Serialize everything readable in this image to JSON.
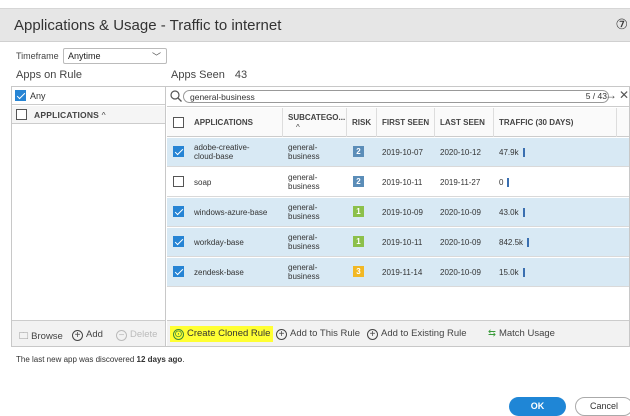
{
  "dialog": {
    "title": "Applications & Usage - Traffic to internet",
    "help_icon": "help-icon"
  },
  "timeframe": {
    "label": "Timeframe",
    "value": "Anytime"
  },
  "left": {
    "header": "Apps on Rule",
    "any_label": "Any",
    "column_header": "APPLICATIONS",
    "sort_glyph": "^",
    "footer": {
      "browse": "Browse",
      "add": "Add",
      "delete": "Delete"
    }
  },
  "right": {
    "header": "Apps Seen",
    "count": "43",
    "search": {
      "value": "general-business",
      "count": "5 / 43"
    },
    "columns": [
      "APPLICATIONS",
      "SUBCATEGO...",
      "RISK",
      "FIRST SEEN",
      "LAST SEEN",
      "TRAFFIC (30 DAYS)"
    ],
    "sort_glyph": "^",
    "rows": [
      {
        "checked": true,
        "app_l1": "adobe-creative-",
        "app_l2": "cloud-base",
        "sub_l1": "general-",
        "sub_l2": "business",
        "risk": "2",
        "risk_color": "#5b8db8",
        "first": "2019-10-07",
        "last": "2020-10-12",
        "traffic": "47.9k"
      },
      {
        "checked": false,
        "app_l1": "soap",
        "app_l2": "",
        "sub_l1": "general-",
        "sub_l2": "business",
        "risk": "2",
        "risk_color": "#5b8db8",
        "first": "2019-10-11",
        "last": "2019-11-27",
        "traffic": "0"
      },
      {
        "checked": true,
        "app_l1": "windows-azure-base",
        "app_l2": "",
        "sub_l1": "general-",
        "sub_l2": "business",
        "risk": "1",
        "risk_color": "#8cc04a",
        "first": "2019-10-09",
        "last": "2020-10-09",
        "traffic": "43.0k"
      },
      {
        "checked": true,
        "app_l1": "workday-base",
        "app_l2": "",
        "sub_l1": "general-",
        "sub_l2": "business",
        "risk": "1",
        "risk_color": "#8cc04a",
        "first": "2019-10-11",
        "last": "2020-10-09",
        "traffic": "842.5k"
      },
      {
        "checked": true,
        "app_l1": "zendesk-base",
        "app_l2": "",
        "sub_l1": "general-",
        "sub_l2": "business",
        "risk": "3",
        "risk_color": "#f2b824",
        "first": "2019-11-14",
        "last": "2020-10-09",
        "traffic": "15.0k"
      }
    ],
    "actions": {
      "create_cloned": "Create Cloned Rule",
      "add_to_this": "Add to This Rule",
      "add_to_existing": "Add to Existing Rule",
      "match_usage": "Match Usage"
    }
  },
  "footnote": {
    "prefix": "The last new app was discovered ",
    "emph": "12 days ago",
    "suffix": "."
  },
  "buttons": {
    "ok": "OK",
    "cancel": "Cancel"
  },
  "colors": {
    "accent": "#1f86d6",
    "selected_row": "#d8e9f4",
    "highlight": "#ffff33"
  }
}
